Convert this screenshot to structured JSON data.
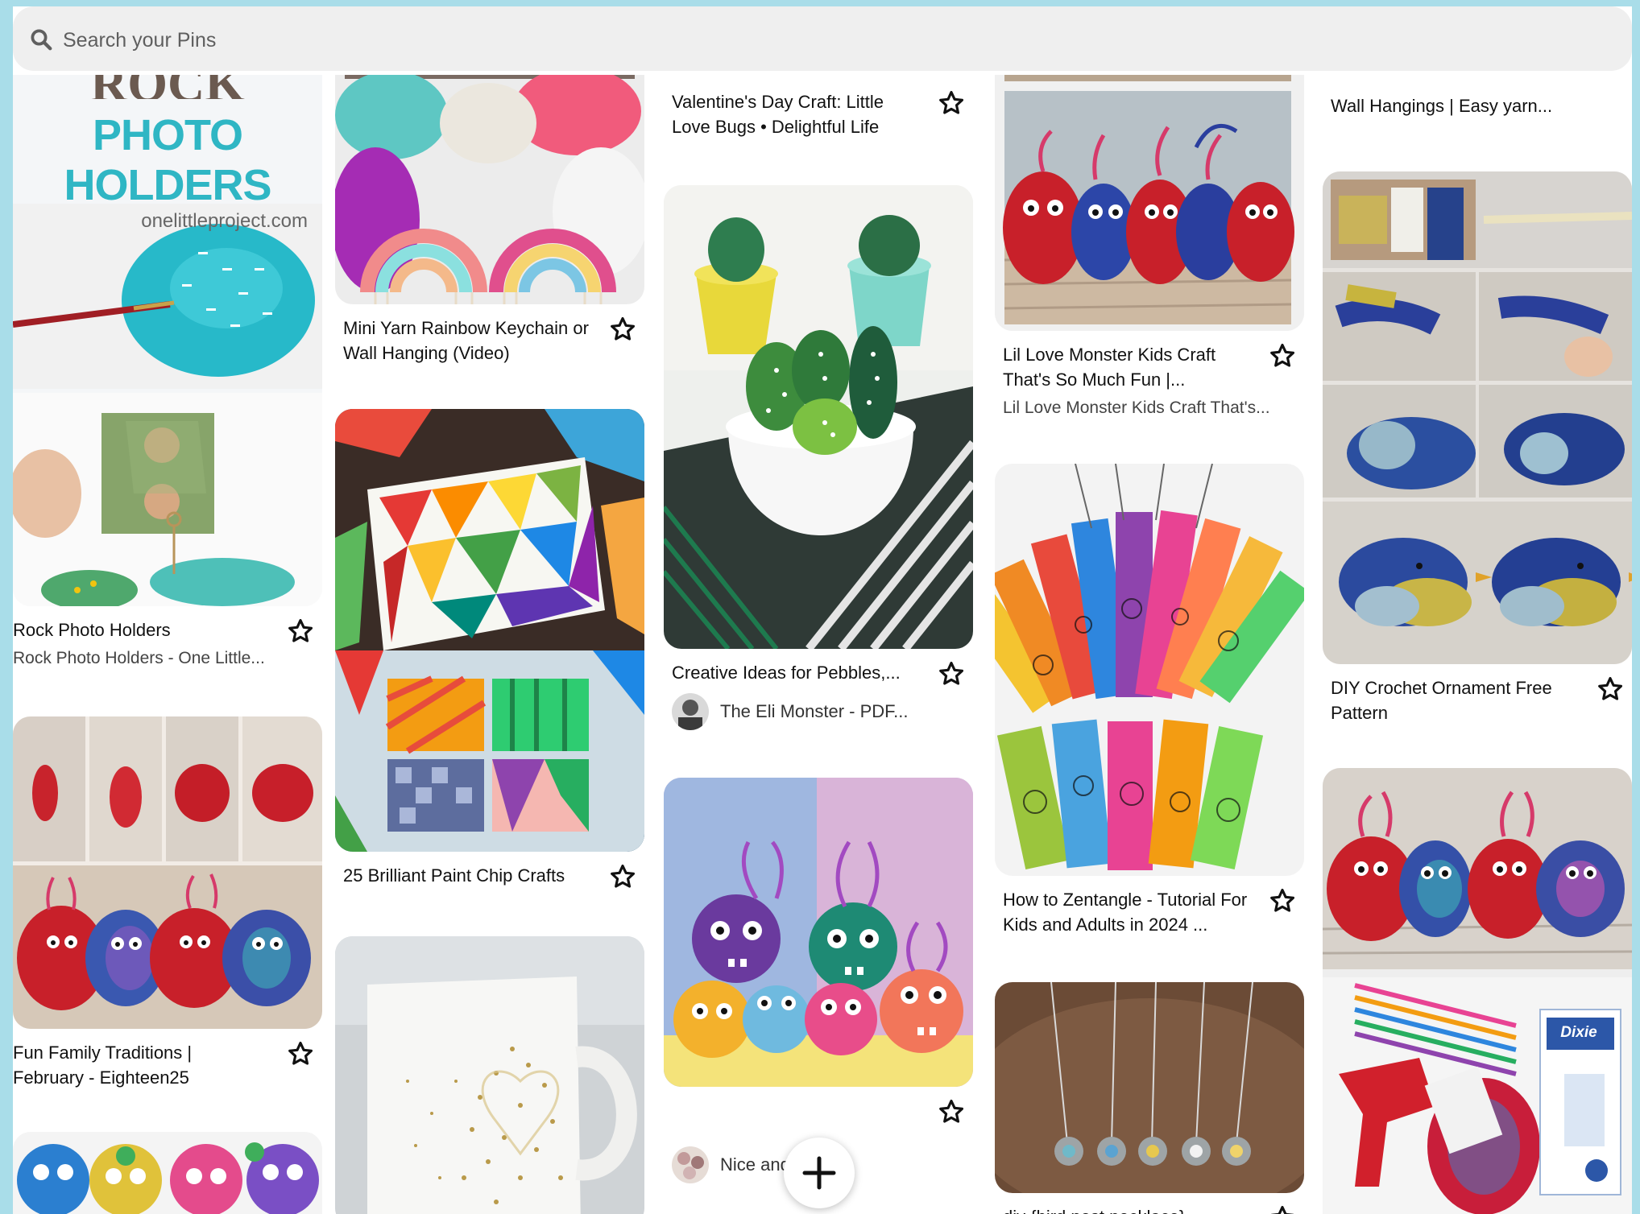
{
  "search": {
    "placeholder": "Search your Pins"
  },
  "pins": {
    "c1p1": {
      "title": "Rock Photo Holders",
      "sub": "Rock Photo Holders - One Little...",
      "overlay_title": "ROCK",
      "overlay_title2": "PHOTO HOLDERS",
      "overlay_url": "onelittleproject.com"
    },
    "c1p2": {
      "title": "Fun Family Traditions | February - Eighteen25"
    },
    "c2p0": {
      "title": "Mini Yarn Rainbow Keychain or Wall Hanging (Video)"
    },
    "c2p1": {
      "title": "25 Brilliant Paint Chip Crafts"
    },
    "c3p0": {
      "title": "Valentine's Day Craft: Little Love Bugs • Delightful Life"
    },
    "c3p1": {
      "title": "Creative Ideas for Pebbles,...",
      "owner": "The Eli Monster - PDF..."
    },
    "c3p2": {
      "owner": "Nice and ... ized"
    },
    "c4p0": {
      "title": "Lil Love Monster Kids Craft That's So Much Fun |...",
      "sub": "Lil Love Monster Kids Craft That's..."
    },
    "c4p1": {
      "title": "How to Zentangle - Tutorial For Kids and Adults in 2024 ..."
    },
    "c4p2": {
      "title": "diy {bird nest necklace}"
    },
    "c5p0": {
      "title": "Wall Hangings | Easy yarn..."
    },
    "c5p1": {
      "title": "DIY Crochet Ornament Free Pattern"
    }
  },
  "colors": {
    "background": "#a9dde9",
    "search_bg": "#efefef"
  },
  "icons": {
    "search": "magnifier-icon",
    "star": "star-outline-icon",
    "add": "plus-icon"
  }
}
